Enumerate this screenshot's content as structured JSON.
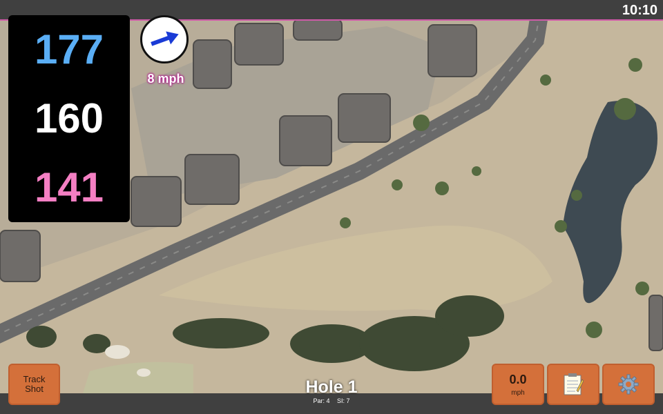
{
  "status_bar": {
    "time": "10:10"
  },
  "distances": {
    "back": "177",
    "middle": "160",
    "front": "141"
  },
  "wind": {
    "speed": "8 mph",
    "direction_icon": "wind-arrow-icon"
  },
  "buttons": {
    "track_shot_line1": "Track",
    "track_shot_line2": "Shot",
    "speed_value": "0.0",
    "speed_unit": "mph",
    "notes_icon": "notepad-icon",
    "settings_icon": "gear-icon"
  },
  "hole": {
    "title": "Hole 1",
    "par": "Par: 4",
    "si": "SI: 7"
  },
  "colors": {
    "back": "#5aaef5",
    "middle": "#ffffff",
    "front": "#f47fc3",
    "button": "#d4703a",
    "accent_border": "#d05aa8"
  }
}
